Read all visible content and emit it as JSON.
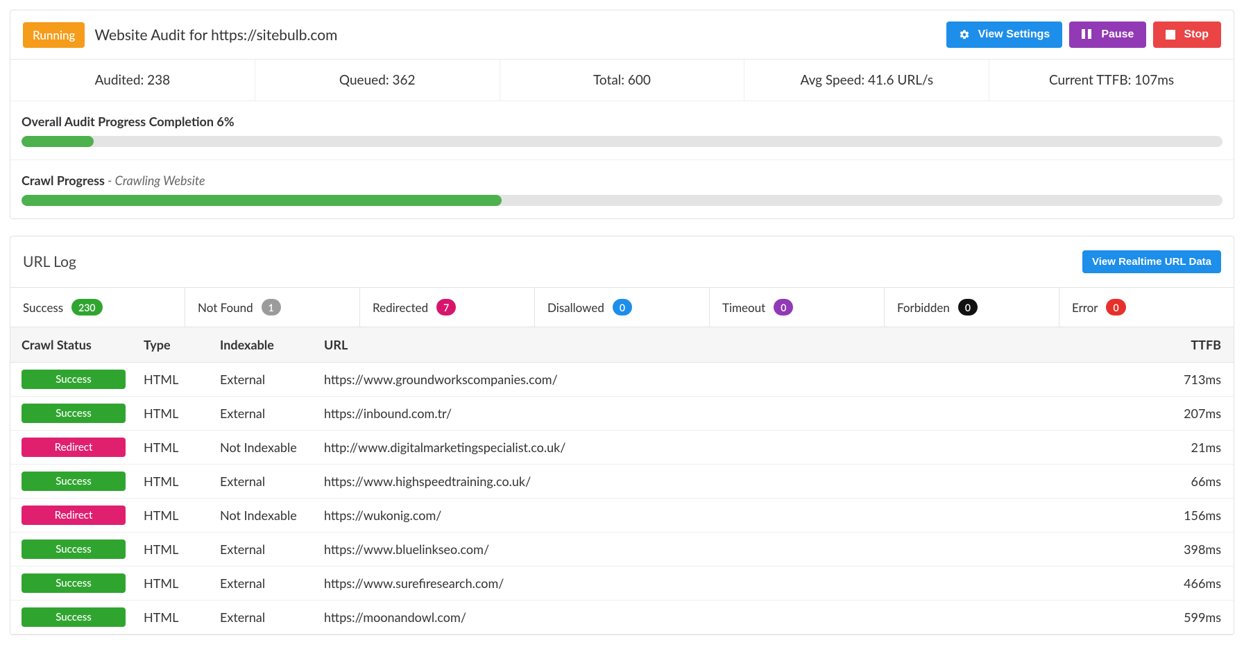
{
  "header": {
    "running_badge": "Running",
    "title": "Website Audit for https://sitebulb.com",
    "view_settings": "View Settings",
    "pause": "Pause",
    "stop": "Stop"
  },
  "stats": {
    "audited": "Audited: 238",
    "queued": "Queued: 362",
    "total": "Total: 600",
    "avg_speed": "Avg Speed: 41.6 URL/s",
    "ttfb": "Current TTFB:  107ms"
  },
  "overall": {
    "label": "Overall Audit Progress Completion 6%",
    "percent": 6
  },
  "crawl": {
    "label": "Crawl Progress",
    "sub": " - Crawling Website",
    "percent": 40
  },
  "log": {
    "title": "URL Log",
    "view_realtime": "View Realtime URL Data",
    "tabs": [
      {
        "label": "Success",
        "count": "230",
        "color": "green"
      },
      {
        "label": "Not Found",
        "count": "1",
        "color": "grey"
      },
      {
        "label": "Redirected",
        "count": "7",
        "color": "pink"
      },
      {
        "label": "Disallowed",
        "count": "0",
        "color": "blue"
      },
      {
        "label": "Timeout",
        "count": "0",
        "color": "purple"
      },
      {
        "label": "Forbidden",
        "count": "0",
        "color": "black"
      },
      {
        "label": "Error",
        "count": "0",
        "color": "red"
      }
    ],
    "columns": {
      "status": "Crawl Status",
      "type": "Type",
      "indexable": "Indexable",
      "url": "URL",
      "ttfb": "TTFB"
    },
    "rows": [
      {
        "status": "Success",
        "type": "HTML",
        "indexable": "External",
        "url": "https://www.groundworkscompanies.com/",
        "ttfb": "713ms"
      },
      {
        "status": "Success",
        "type": "HTML",
        "indexable": "External",
        "url": "https://inbound.com.tr/",
        "ttfb": "207ms"
      },
      {
        "status": "Redirect",
        "type": "HTML",
        "indexable": "Not Indexable",
        "url": "http://www.digitalmarketingspecialist.co.uk/",
        "ttfb": "21ms"
      },
      {
        "status": "Success",
        "type": "HTML",
        "indexable": "External",
        "url": "https://www.highspeedtraining.co.uk/",
        "ttfb": "66ms"
      },
      {
        "status": "Redirect",
        "type": "HTML",
        "indexable": "Not Indexable",
        "url": "https://wukonig.com/",
        "ttfb": "156ms"
      },
      {
        "status": "Success",
        "type": "HTML",
        "indexable": "External",
        "url": "https://www.bluelinkseo.com/",
        "ttfb": "398ms"
      },
      {
        "status": "Success",
        "type": "HTML",
        "indexable": "External",
        "url": "https://www.surefiresearch.com/",
        "ttfb": "466ms"
      },
      {
        "status": "Success",
        "type": "HTML",
        "indexable": "External",
        "url": "https://moonandowl.com/",
        "ttfb": "599ms"
      }
    ]
  }
}
